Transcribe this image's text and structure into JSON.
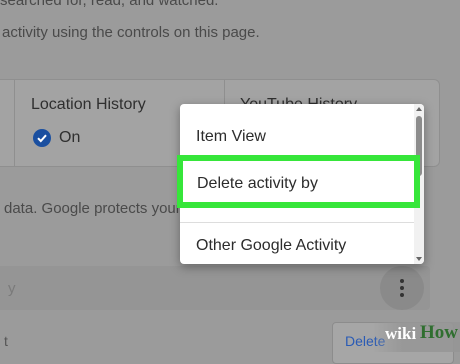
{
  "text": {
    "top_partial": "searched for, read, and watched.",
    "controls_line": "activity using the controls on this page.",
    "protects_line": "data. Google protects your p",
    "search_hint": "y",
    "bottom_partial": "t"
  },
  "cards": {
    "location_history": {
      "title": "Location History",
      "status": "On"
    },
    "youtube_history": {
      "title": "YouTube History"
    }
  },
  "more_menu": {
    "items": [
      "Item View",
      "Delete activity by",
      "Other Google Activity"
    ],
    "highlighted_index": 1
  },
  "delete_button_label": "Delete",
  "colors": {
    "highlight": "#36e63a",
    "check_blue": "#1a4fa0"
  },
  "icons": [
    "check-circle-icon",
    "more-vert-icon"
  ],
  "watermark": {
    "wiki": "wiki",
    "how": "How"
  }
}
